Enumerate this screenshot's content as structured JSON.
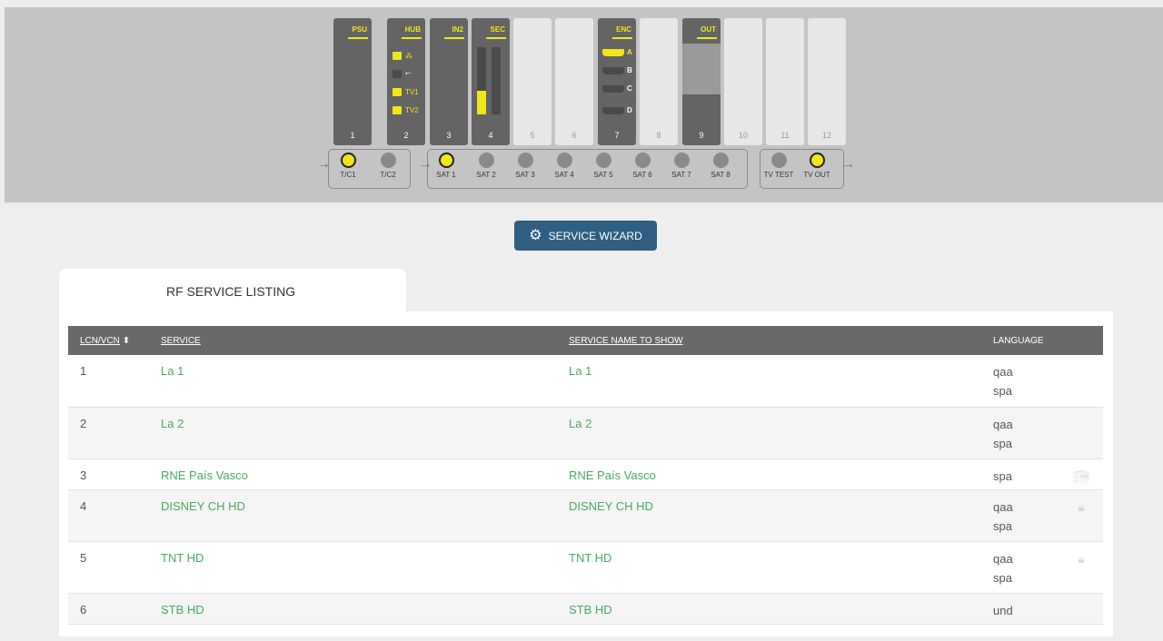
{
  "rack": {
    "slots": [
      {
        "num": "1",
        "label": "PSU",
        "dark": true
      },
      {
        "num": "2",
        "label": "HUB",
        "dark": true
      },
      {
        "num": "3",
        "label": "IN2",
        "dark": true
      },
      {
        "num": "4",
        "label": "SEC",
        "dark": true
      },
      {
        "num": "5",
        "label": "",
        "dark": false
      },
      {
        "num": "6",
        "label": "",
        "dark": false
      },
      {
        "num": "7",
        "label": "ENC",
        "dark": true
      },
      {
        "num": "8",
        "label": "",
        "dark": false
      },
      {
        "num": "9",
        "label": "OUT",
        "dark": true
      },
      {
        "num": "10",
        "label": "",
        "dark": false
      },
      {
        "num": "11",
        "label": "",
        "dark": false
      },
      {
        "num": "12",
        "label": "",
        "dark": false
      }
    ],
    "hub_ports": [
      "",
      "",
      "TV1",
      "TV2"
    ],
    "enc_outputs": [
      "A",
      "B",
      "C",
      "D"
    ],
    "sec_level": 0.35,
    "out_level": 0.5,
    "connectors": [
      {
        "name": "T/C1",
        "active": true
      },
      {
        "name": "T/C2",
        "active": false
      },
      {
        "name": "SAT 1",
        "active": true
      },
      {
        "name": "SAT 2",
        "active": false
      },
      {
        "name": "SAT 3",
        "active": false
      },
      {
        "name": "SAT 4",
        "active": false
      },
      {
        "name": "SAT 5",
        "active": false
      },
      {
        "name": "SAT 6",
        "active": false
      },
      {
        "name": "SAT 7",
        "active": false
      },
      {
        "name": "SAT 8",
        "active": false
      },
      {
        "name": "TV TEST",
        "active": false
      },
      {
        "name": "TV OUT",
        "active": true
      }
    ],
    "accent_color": "#f2e61a"
  },
  "wizard": {
    "label": "SERVICE WIZARD",
    "icon": "gear-icon",
    "color": "#2e5e80"
  },
  "tab": {
    "label": "RF SERVICE LISTING"
  },
  "table": {
    "headers": {
      "lcn": "LCN/VCN",
      "service": "SERVICE",
      "service_name": "SERVICE NAME TO SHOW",
      "language": "LANGUAGE"
    },
    "rows": [
      {
        "lcn": "1",
        "service": "La 1",
        "name": "La 1",
        "lang": [
          "qaa",
          "spa"
        ],
        "icon": ""
      },
      {
        "lcn": "2",
        "service": "La 2",
        "name": "La 2",
        "lang": [
          "qaa",
          "spa"
        ],
        "icon": ""
      },
      {
        "lcn": "3",
        "service": "RNE País Vasco",
        "name": "RNE País Vasco",
        "lang": [
          "spa"
        ],
        "icon": "radio-icon"
      },
      {
        "lcn": "4",
        "service": "DISNEY CH HD",
        "name": "DISNEY CH HD",
        "lang": [
          "qaa",
          "spa"
        ],
        "icon": "lock-icon"
      },
      {
        "lcn": "5",
        "service": "TNT HD",
        "name": "TNT HD",
        "lang": [
          "qaa",
          "spa"
        ],
        "icon": "lock-icon"
      },
      {
        "lcn": "6",
        "service": "STB HD",
        "name": "STB HD",
        "lang": [
          "und"
        ],
        "icon": ""
      }
    ]
  }
}
